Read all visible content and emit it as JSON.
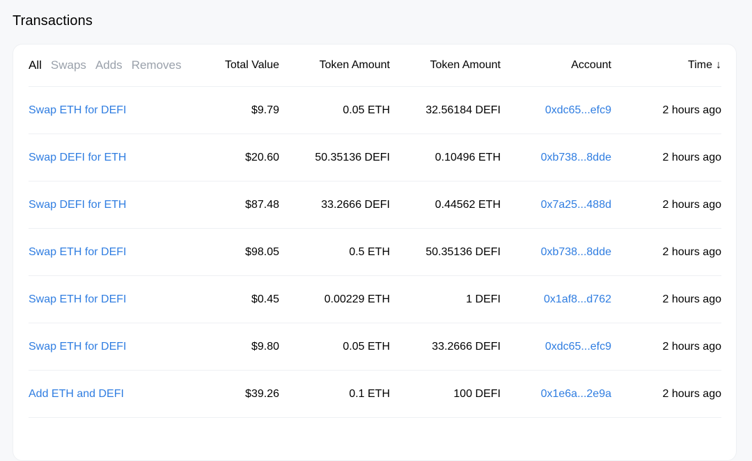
{
  "title": "Transactions",
  "filters": [
    "All",
    "Swaps",
    "Adds",
    "Removes"
  ],
  "columns": {
    "total_value": "Total Value",
    "token_amount_1": "Token Amount",
    "token_amount_2": "Token Amount",
    "account": "Account",
    "time": "Time",
    "time_sort_icon": "↓"
  },
  "colors": {
    "link": "#2f7de1",
    "muted": "#9aa1ab",
    "background": "#f7f8fa"
  },
  "rows": [
    {
      "type": "Swap ETH for DEFI",
      "total": "$9.79",
      "token1": "0.05 ETH",
      "token2": "32.56184 DEFI",
      "account": "0xdc65...efc9",
      "time": "2 hours ago"
    },
    {
      "type": "Swap DEFI for ETH",
      "total": "$20.60",
      "token1": "50.35136 DEFI",
      "token2": "0.10496 ETH",
      "account": "0xb738...8dde",
      "time": "2 hours ago"
    },
    {
      "type": "Swap DEFI for ETH",
      "total": "$87.48",
      "token1": "33.2666 DEFI",
      "token2": "0.44562 ETH",
      "account": "0x7a25...488d",
      "time": "2 hours ago"
    },
    {
      "type": "Swap ETH for DEFI",
      "total": "$98.05",
      "token1": "0.5 ETH",
      "token2": "50.35136 DEFI",
      "account": "0xb738...8dde",
      "time": "2 hours ago"
    },
    {
      "type": "Swap ETH for DEFI",
      "total": "$0.45",
      "token1": "0.00229 ETH",
      "token2": "1 DEFI",
      "account": "0x1af8...d762",
      "time": "2 hours ago"
    },
    {
      "type": "Swap ETH for DEFI",
      "total": "$9.80",
      "token1": "0.05 ETH",
      "token2": "33.2666 DEFI",
      "account": "0xdc65...efc9",
      "time": "2 hours ago"
    },
    {
      "type": "Add ETH and DEFI",
      "total": "$39.26",
      "token1": "0.1 ETH",
      "token2": "100 DEFI",
      "account": "0x1e6a...2e9a",
      "time": "2 hours ago"
    }
  ]
}
